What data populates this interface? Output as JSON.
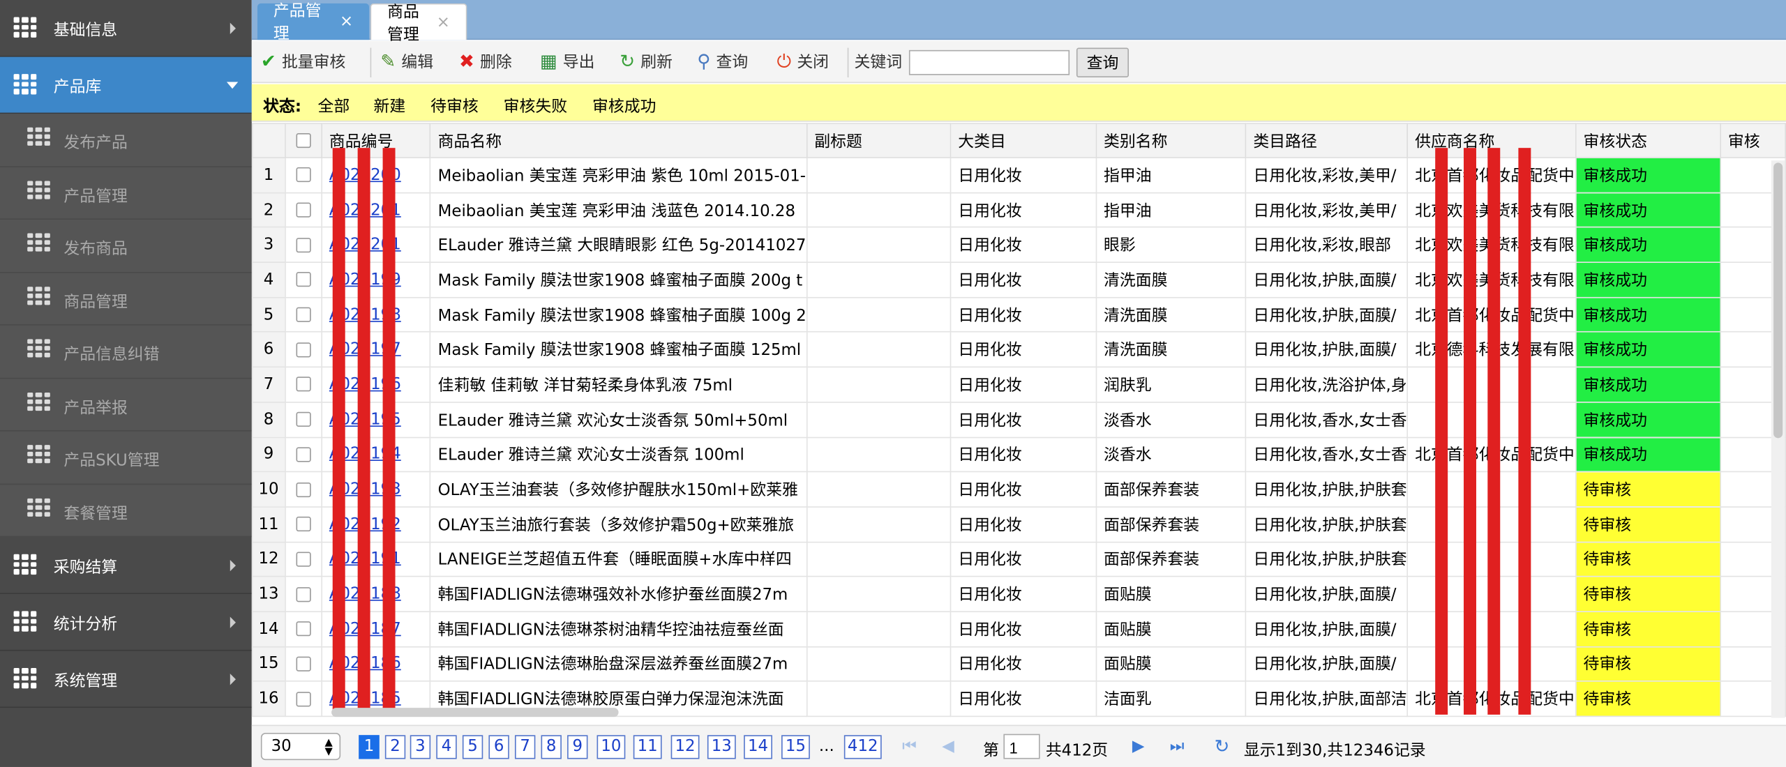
{
  "sidebar": {
    "groups": [
      {
        "label": "基础信息",
        "icon": "grid-icon"
      },
      {
        "label": "产品库",
        "icon": "grid-icon"
      },
      {
        "label": "采购结算",
        "icon": "grid-icon"
      },
      {
        "label": "统计分析",
        "icon": "grid-icon"
      },
      {
        "label": "系统管理",
        "icon": "grid-icon"
      }
    ],
    "items": [
      {
        "label": "发布产品"
      },
      {
        "label": "产品管理"
      },
      {
        "label": "发布商品"
      },
      {
        "label": "商品管理"
      },
      {
        "label": "产品信息纠错"
      },
      {
        "label": "产品举报"
      },
      {
        "label": "产品SKU管理"
      },
      {
        "label": "套餐管理"
      }
    ]
  },
  "tabs": [
    {
      "label": "产品管理",
      "close": "×"
    },
    {
      "label": "商品管理",
      "close": "×"
    }
  ],
  "toolbar": {
    "batch_audit": "批量审核",
    "edit": "编辑",
    "delete": "删除",
    "export": "导出",
    "refresh": "刷新",
    "query": "查询",
    "close": "关闭",
    "keyword_label": "关键词",
    "keyword_value": "",
    "search_button": "查询"
  },
  "status_filter": {
    "label": "状态:",
    "options": [
      "全部",
      "新建",
      "待审核",
      "审核失败",
      "审核成功"
    ]
  },
  "table": {
    "columns": [
      "商品编号",
      "商品名称",
      "副标题",
      "大类目",
      "类别名称",
      "类目路径",
      "供应商名称",
      "审核状态",
      "审核"
    ],
    "rows": [
      {
        "n": "1",
        "code": "A022200",
        "name": "Meibaolian 美宝莲 亮彩甲油 紫色 10ml 2015-01-",
        "sub": "",
        "cat": "日用化妆",
        "type": "指甲油",
        "path": "日用化妆,彩妆,美甲/",
        "supplier": "北京首都化妆品配货中",
        "status": "审核成功",
        "st": "ok"
      },
      {
        "n": "2",
        "code": "A022201",
        "name": "Meibaolian 美宝莲 亮彩甲油 浅蓝色 2014.10.28",
        "sub": "",
        "cat": "日用化妆",
        "type": "指甲油",
        "path": "日用化妆,彩妆,美甲/",
        "supplier": "北京欢美美货科技有限",
        "status": "审核成功",
        "st": "ok"
      },
      {
        "n": "3",
        "code": "A022201",
        "name": "ELauder 雅诗兰黛 大眼睛眼影 红色 5g-20141027",
        "sub": "",
        "cat": "日用化妆",
        "type": "眼影",
        "path": "日用化妆,彩妆,眼部",
        "supplier": "北京欢美美货科技有限",
        "status": "审核成功",
        "st": "ok"
      },
      {
        "n": "4",
        "code": "A022199",
        "name": "Mask Family 膜法世家1908 蜂蜜柚子面膜 200g t",
        "sub": "",
        "cat": "日用化妆",
        "type": "清洗面膜",
        "path": "日用化妆,护肤,面膜/",
        "supplier": "北京欢美美货科技有限",
        "status": "审核成功",
        "st": "ok"
      },
      {
        "n": "5",
        "code": "A022198",
        "name": "Mask Family 膜法世家1908 蜂蜜柚子面膜 100g 2",
        "sub": "",
        "cat": "日用化妆",
        "type": "清洗面膜",
        "path": "日用化妆,护肤,面膜/",
        "supplier": "北京首都化妆品配货中",
        "status": "审核成功",
        "st": "ok"
      },
      {
        "n": "6",
        "code": "A022197",
        "name": "Mask Family 膜法世家1908 蜂蜜柚子面膜 125ml",
        "sub": "",
        "cat": "日用化妆",
        "type": "清洗面膜",
        "path": "日用化妆,护肤,面膜/",
        "supplier": "北京德科科技发展有限",
        "status": "审核成功",
        "st": "ok"
      },
      {
        "n": "7",
        "code": "A022196",
        "name": "佳莉敏 佳莉敏 洋甘菊轻柔身体乳液 75ml",
        "sub": "",
        "cat": "日用化妆",
        "type": "润肤乳",
        "path": "日用化妆,洗浴护体,身",
        "supplier": "",
        "status": "审核成功",
        "st": "ok"
      },
      {
        "n": "8",
        "code": "A022195",
        "name": "ELauder 雅诗兰黛 欢沁女士淡香氛 50ml+50ml",
        "sub": "",
        "cat": "日用化妆",
        "type": "淡香水",
        "path": "日用化妆,香水,女士香",
        "supplier": "",
        "status": "审核成功",
        "st": "ok"
      },
      {
        "n": "9",
        "code": "A022194",
        "name": "ELauder 雅诗兰黛 欢沁女士淡香氛 100ml",
        "sub": "",
        "cat": "日用化妆",
        "type": "淡香水",
        "path": "日用化妆,香水,女士香",
        "supplier": "北京首都化妆品配货中",
        "status": "审核成功",
        "st": "ok"
      },
      {
        "n": "10",
        "code": "A022193",
        "name": "OLAY玉兰油套装（多效修护醒肤水150ml+欧莱雅",
        "sub": "",
        "cat": "日用化妆",
        "type": "面部保养套装",
        "path": "日用化妆,护肤,护肤套",
        "supplier": "",
        "status": "待审核",
        "st": "wait"
      },
      {
        "n": "11",
        "code": "A022192",
        "name": "OLAY玉兰油旅行套装（多效修护霜50g+欧莱雅旅",
        "sub": "",
        "cat": "日用化妆",
        "type": "面部保养套装",
        "path": "日用化妆,护肤,护肤套",
        "supplier": "",
        "status": "待审核",
        "st": "wait"
      },
      {
        "n": "12",
        "code": "A022191",
        "name": "LANEIGE兰芝超值五件套（睡眠面膜+水库中样四",
        "sub": "",
        "cat": "日用化妆",
        "type": "面部保养套装",
        "path": "日用化妆,护肤,护肤套",
        "supplier": "",
        "status": "待审核",
        "st": "wait"
      },
      {
        "n": "13",
        "code": "A022188",
        "name": "韩国FIADLIGN法德琳强效补水修护蚕丝面膜27m",
        "sub": "",
        "cat": "日用化妆",
        "type": "面贴膜",
        "path": "日用化妆,护肤,面膜/",
        "supplier": "",
        "status": "待审核",
        "st": "wait"
      },
      {
        "n": "14",
        "code": "A022187",
        "name": "韩国FIADLIGN法德琳茶树油精华控油祛痘蚕丝面",
        "sub": "",
        "cat": "日用化妆",
        "type": "面贴膜",
        "path": "日用化妆,护肤,面膜/",
        "supplier": "",
        "status": "待审核",
        "st": "wait"
      },
      {
        "n": "15",
        "code": "A022186",
        "name": "韩国FIADLIGN法德琳胎盘深层滋养蚕丝面膜27m",
        "sub": "",
        "cat": "日用化妆",
        "type": "面贴膜",
        "path": "日用化妆,护肤,面膜/",
        "supplier": "",
        "status": "待审核",
        "st": "wait"
      },
      {
        "n": "16",
        "code": "A022185",
        "name": "韩国FIADLIGN法德琳胶原蛋白弹力保湿泡沫洗面",
        "sub": "",
        "cat": "日用化妆",
        "type": "洁面乳",
        "path": "日用化妆,护肤,面部洁",
        "supplier": "北京首都化妆品配货中",
        "status": "待审核",
        "st": "wait"
      }
    ]
  },
  "pager": {
    "page_size": "30",
    "pages": [
      "1",
      "2",
      "3",
      "4",
      "5",
      "6",
      "7",
      "8",
      "9",
      "10",
      "11",
      "12",
      "13",
      "14",
      "15"
    ],
    "ellipsis": "...",
    "last_page": "412",
    "page_prefix": "第",
    "current_page": "1",
    "page_suffix": "共412页",
    "summary": "显示1到30,共12346记录"
  },
  "colors": {
    "accent": "#3d87c9",
    "status_ok": "#22ee44",
    "status_wait": "#ffff33",
    "redaction": "#e02020"
  }
}
